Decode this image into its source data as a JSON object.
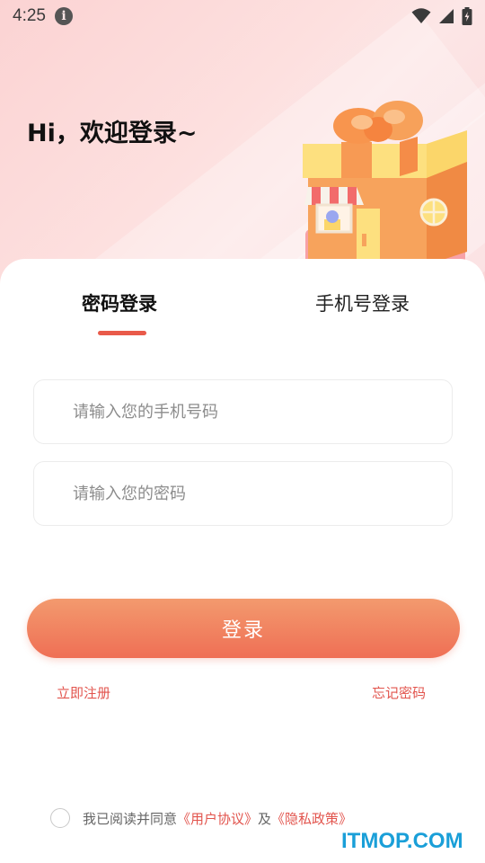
{
  "status_bar": {
    "time": "4:25",
    "info_icon": "info-icon",
    "wifi_icon": "wifi-icon",
    "signal_icon": "signal-icon",
    "battery_icon": "battery-charging-icon"
  },
  "header": {
    "greeting": "Hi，欢迎登录~"
  },
  "tabs": [
    {
      "label": "密码登录",
      "active": true
    },
    {
      "label": "手机号登录",
      "active": false
    }
  ],
  "form": {
    "phone_placeholder": "请输入您的手机号码",
    "password_placeholder": "请输入您的密码",
    "login_label": "登录"
  },
  "links": {
    "register": "立即注册",
    "forgot": "忘记密码"
  },
  "agreement": {
    "prefix": "我已阅读并同意",
    "user_agreement": "《用户协议》",
    "and": "及",
    "privacy": "《隐私政策》"
  },
  "watermark": "ITMOP.COM",
  "colors": {
    "accent": "#e95a4a",
    "button_top": "#f39a6e",
    "button_bottom": "#ef6f55",
    "link": "#e2544d"
  }
}
